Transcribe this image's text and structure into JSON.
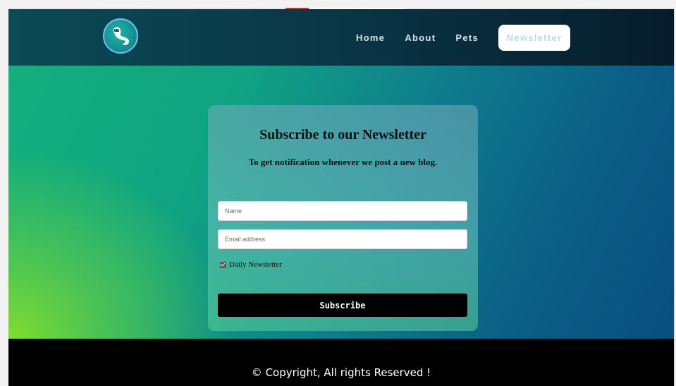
{
  "header": {
    "logo_icon": "ferret-logo-icon",
    "nav": [
      {
        "label": "Home"
      },
      {
        "label": "About"
      },
      {
        "label": "Pets"
      }
    ],
    "active_label": "Newsletter"
  },
  "form": {
    "title": "Subscribe to our Newsletter",
    "subtitle": "To get notification whenever we post a new blog.",
    "name_placeholder": "Name",
    "email_placeholder": "Email address",
    "checkbox_label": "Daily Newsletter",
    "checkbox_checked": true,
    "submit_label": "Subscribe"
  },
  "footer": {
    "copyright": "© Copyright, All rights Reserved !"
  },
  "colors": {
    "header_bg": "#0a3848",
    "footer_bg": "#000000",
    "button_bg": "#000000",
    "accent_green": "#12b07c",
    "accent_blue": "#0b5d86"
  }
}
